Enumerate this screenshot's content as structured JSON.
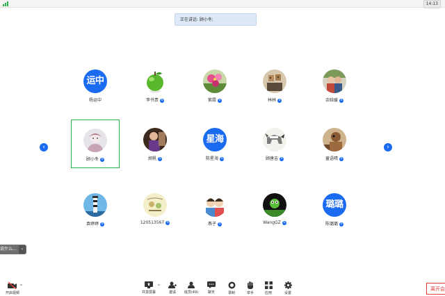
{
  "status_bar": {
    "time": "14:13",
    "signal_icon": "signal-bars-icon"
  },
  "speaking": {
    "text": "正在讲话: 顾小冬;"
  },
  "participants": [
    {
      "name": "杨运中",
      "avatar_text": "运中",
      "badge": ""
    },
    {
      "name": "李书贵",
      "avatar_text": "",
      "badge": "S"
    },
    {
      "name": "紫霞",
      "avatar_text": "",
      "badge": "S"
    },
    {
      "name": "林林",
      "avatar_text": "",
      "badge": "S"
    },
    {
      "name": "余晗媛",
      "avatar_text": "",
      "badge": "S"
    },
    {
      "name": "顾小冬",
      "avatar_text": "",
      "badge": "S"
    },
    {
      "name": "胡帆",
      "avatar_text": "",
      "badge": "S"
    },
    {
      "name": "陈星海",
      "avatar_text": "星海",
      "badge": "S"
    },
    {
      "name": "顾唐吉",
      "avatar_text": "",
      "badge": "S"
    },
    {
      "name": "童语晴",
      "avatar_text": "",
      "badge": "S"
    },
    {
      "name": "袁婷婷",
      "avatar_text": "",
      "badge": "S"
    },
    {
      "name": "120513567",
      "avatar_text": "",
      "badge": "S"
    },
    {
      "name": "燕子",
      "avatar_text": "",
      "badge": "S"
    },
    {
      "name": "WangGZ",
      "avatar_text": "",
      "badge": "S"
    },
    {
      "name": "陈璐璐",
      "avatar_text": "璐璐",
      "badge": "S"
    }
  ],
  "nav": {
    "prev": "‹",
    "next": "›"
  },
  "chat_popup": {
    "text": "说什么...",
    "collapse": "‹"
  },
  "toolbar": {
    "video": "开启视频",
    "share": "共享屏幕",
    "invite": "邀请",
    "members": "成员(49)",
    "chat": "聊天",
    "record": "录制",
    "raise_hand": "举手",
    "apps": "应用",
    "settings": "设置"
  },
  "leave_label": "离开会议",
  "colors": {
    "accent": "#1a6bf0",
    "active_border": "#27b24a",
    "leave": "#e23b3b"
  }
}
